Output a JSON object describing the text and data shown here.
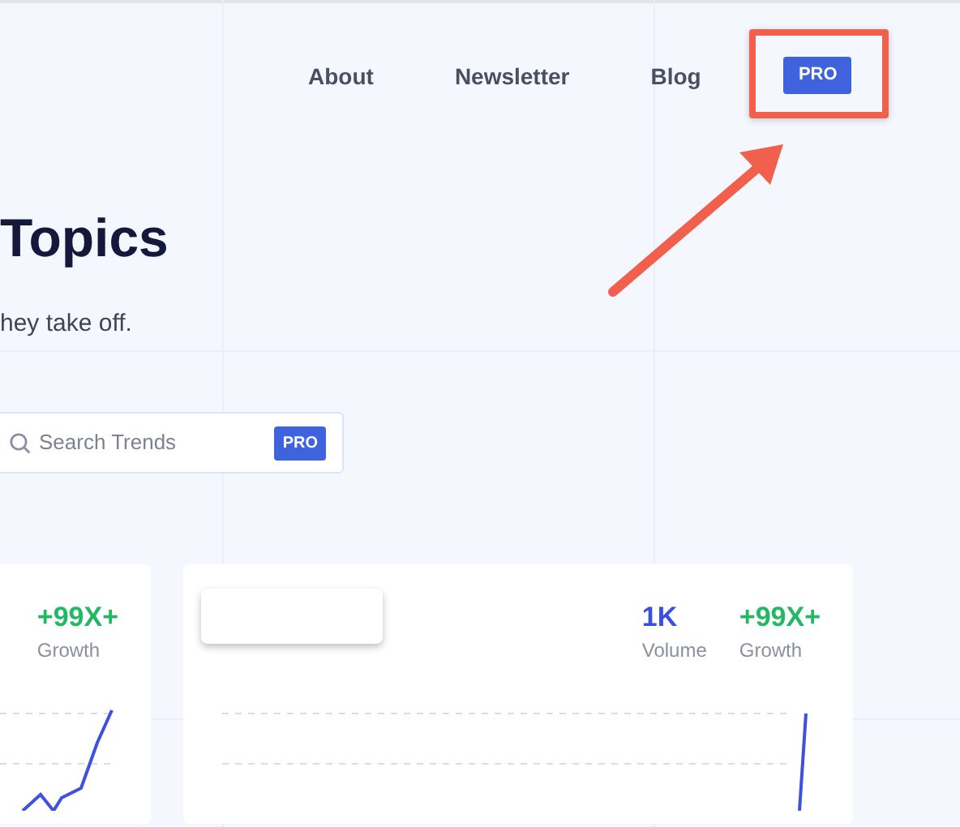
{
  "nav": {
    "links": [
      "About",
      "Newsletter",
      "Blog"
    ],
    "pro_button": "PRO"
  },
  "hero": {
    "title": "Topics",
    "subtitle": "hey take off."
  },
  "search": {
    "placeholder": "Search Trends",
    "badge": "PRO"
  },
  "cards": [
    {
      "stats": [
        {
          "kind": "growth",
          "value": "+99X+",
          "label": "Growth"
        }
      ]
    },
    {
      "stats": [
        {
          "kind": "volume",
          "value": "1K",
          "label": "Volume"
        },
        {
          "kind": "growth",
          "value": "+99X+",
          "label": "Growth"
        }
      ]
    }
  ]
}
